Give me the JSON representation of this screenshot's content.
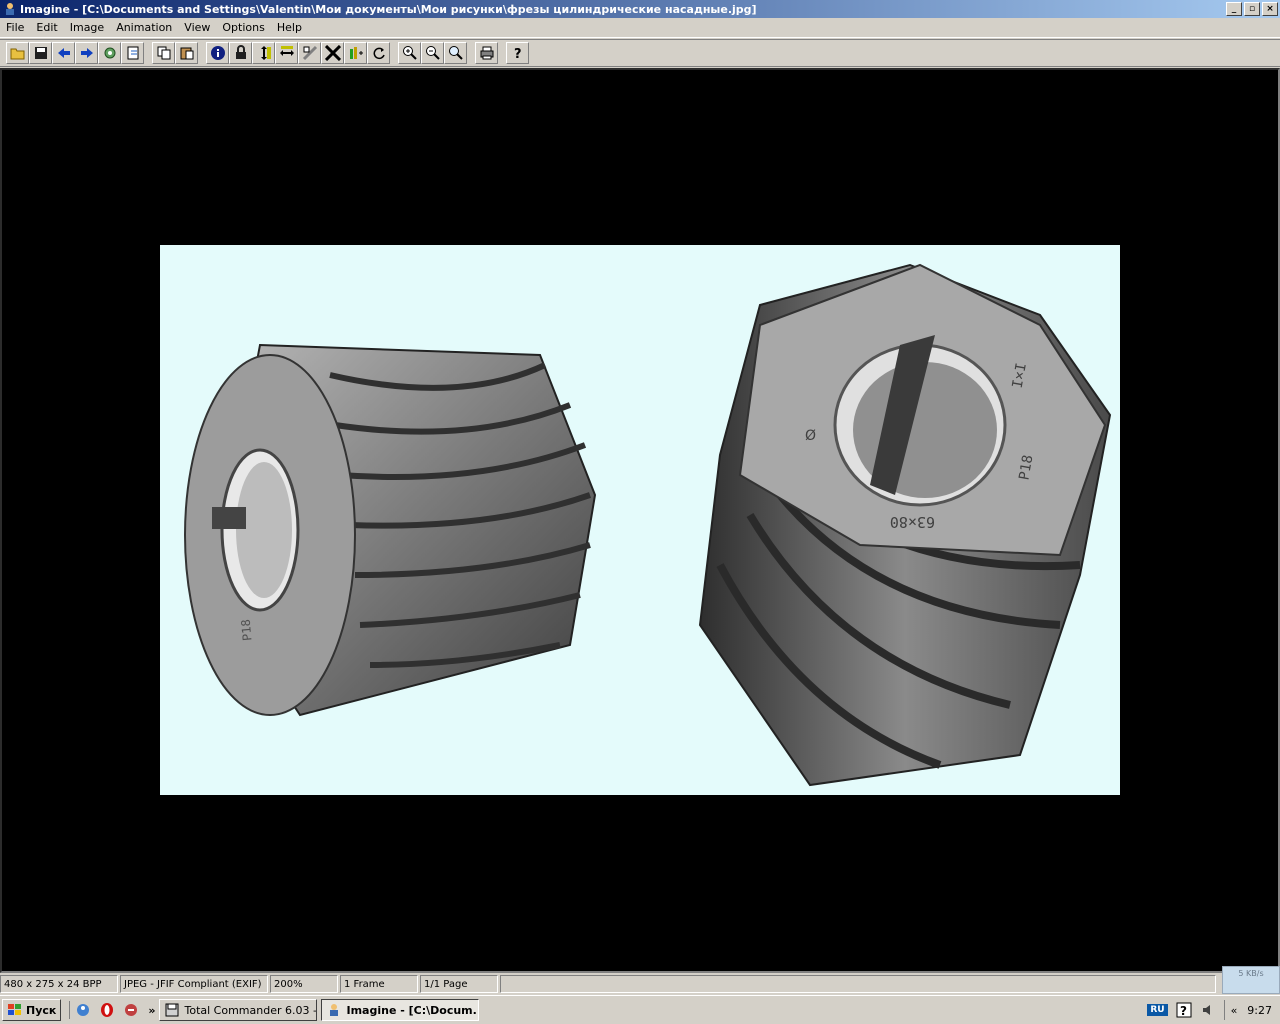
{
  "window": {
    "title": "Imagine - [C:\\Documents and Settings\\Valentin\\Мои документы\\Мои рисунки\\фрезы цилиндрические насадные.jpg]",
    "controls": {
      "minimize": "_",
      "restore": "▫",
      "close": "×"
    }
  },
  "menu": [
    "File",
    "Edit",
    "Image",
    "Animation",
    "View",
    "Options",
    "Help"
  ],
  "toolbar": {
    "groups": [
      [
        "open-folder-icon",
        "save-icon",
        "back-arrow-icon",
        "forward-arrow-icon",
        "settings-icon",
        "export-icon"
      ],
      [
        "copy-icon",
        "paste-icon"
      ],
      [
        "info-icon",
        "lock-icon",
        "resize-vertical-icon",
        "resize-horizontal-icon",
        "crop-icon",
        "fit-icon",
        "levels-icon",
        "rotate-icon"
      ],
      [
        "zoom-in-icon",
        "zoom-out-icon",
        "zoom-fit-icon"
      ],
      [
        "print-icon"
      ],
      [
        "help-icon"
      ]
    ]
  },
  "image": {
    "stamped_text": [
      "63×80",
      "P18",
      "I×I",
      "Ø",
      "P18"
    ]
  },
  "status": {
    "dimensions": "480 x 275 x 24 BPP",
    "format": "JPEG - JFIF Compliant (EXIF)",
    "zoom": "200%",
    "frames": "1 Frame",
    "page": "1/1 Page"
  },
  "net_meter": "5 KB/s",
  "taskbar": {
    "start_label": "Пуск",
    "tasks": [
      {
        "label": "Total Commander 6.03 - ...",
        "active": false
      },
      {
        "label": "Imagine - [C:\\Docum...",
        "active": true
      }
    ],
    "chevron": "»",
    "tray": {
      "language": "RU",
      "arrows": "«",
      "clock": "9:27"
    }
  },
  "colors": {
    "title_gradient_start": "#0a246a",
    "title_gradient_end": "#a6caf0",
    "viewer_bg": "#000000",
    "image_bg": "#e4fbfb",
    "chrome": "#d4d0c8"
  }
}
